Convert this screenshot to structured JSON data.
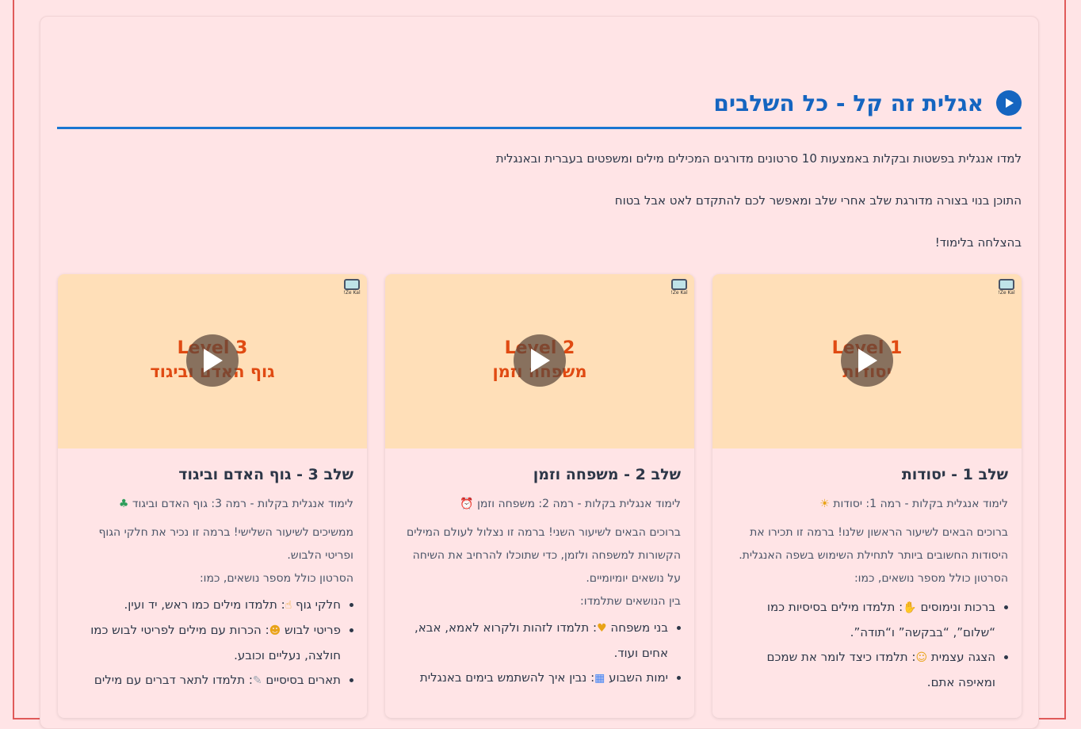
{
  "header": {
    "title": "אגלית זה קל - כל השלבים",
    "play_icon": "play-circle-icon",
    "accent_color": "#1565c0"
  },
  "intro": {
    "line1": "למדו אנגלית בפשטות ובקלות באמצעות 10 סרטונים מדורגים המכילים מילים ומשפטים בעברית ובאנגלית",
    "line2": "התוכן בנוי בצורה מדורגת שלב אחרי שלב ומאפשר לכם להתקדם לאט אבל בטוח",
    "line3": "בהצלחה בלימוד!"
  },
  "cards": [
    {
      "logo_text": "Ze Kal!",
      "thumb_level": "Level 1",
      "thumb_topic": "יסודות",
      "title": "שלב 1 - יסודות",
      "subtitle": "לימוד אנגלית בקלות - רמה 1: יסודות",
      "subtitle_emoji": "☀",
      "description": "ברוכים הבאים לשיעור הראשון שלנו! ברמה זו תכירו את היסודות החשובים ביותר לתחילת השימוש בשפה האנגלית. הסרטון כולל מספר נושאים, כמו:",
      "topics_label": "",
      "topics": [
        {
          "name": "ברכות ונימוסים",
          "emoji": "✋",
          "text": ": תלמדו מילים בסיסיות כמו “שלום”, “בבקשה” ו“תודה”."
        },
        {
          "name": "הצגה עצמית",
          "emoji": "☺",
          "text": ": תלמדו כיצד לומר את שמכם ומאיפה אתם."
        }
      ]
    },
    {
      "logo_text": "Ze Kal!",
      "thumb_level": "Level 2",
      "thumb_topic": "משפחה וזמן",
      "title": "שלב 2 - משפחה וזמן",
      "subtitle": "לימוד אנגלית בקלות - רמה 2: משפחה וזמן",
      "subtitle_emoji": "⏰",
      "description": "ברוכים הבאים לשיעור השני! ברמה זו נצלול לעולם המילים הקשורות למשפחה ולזמן, כדי שתוכלו להרחיב את השיחה על נושאים יומיומיים.",
      "topics_label": "בין הנושאים שתלמדו:",
      "topics": [
        {
          "name": "בני משפחה",
          "emoji": "♥",
          "text": ": תלמדו לזהות ולקרוא לאמא, אבא, אחים ועוד."
        },
        {
          "name": "ימות השבוע",
          "emoji": "▦",
          "text": ": נבין איך להשתמש בימים באנגלית"
        }
      ]
    },
    {
      "logo_text": "Ze Kal!",
      "thumb_level": "Level 3",
      "thumb_topic": "גוף האדם וביגוד",
      "title": "שלב 3 - גוף האדם וביגוד",
      "subtitle": "לימוד אנגלית בקלות - רמה 3: גוף האדם וביגוד",
      "subtitle_emoji": "♣",
      "description": "ממשיכים לשיעור השלישי! ברמה זו נכיר את חלקי הגוף ופריטי הלבוש.",
      "topics_label": "הסרטון כולל מספר נושאים, כמו:",
      "topics": [
        {
          "name": "חלקי גוף",
          "emoji": "☝",
          "text": ": תלמדו מילים כמו ראש, יד ועין."
        },
        {
          "name": "פריטי לבוש",
          "emoji": "☻",
          "text": ": הכרות עם מילים לפריטי לבוש כמו חולצה, נעליים וכובע."
        },
        {
          "name": "תארים בסיסיים",
          "emoji": "✎",
          "text": ": תלמדו לתאר דברים עם מילים"
        }
      ]
    }
  ]
}
